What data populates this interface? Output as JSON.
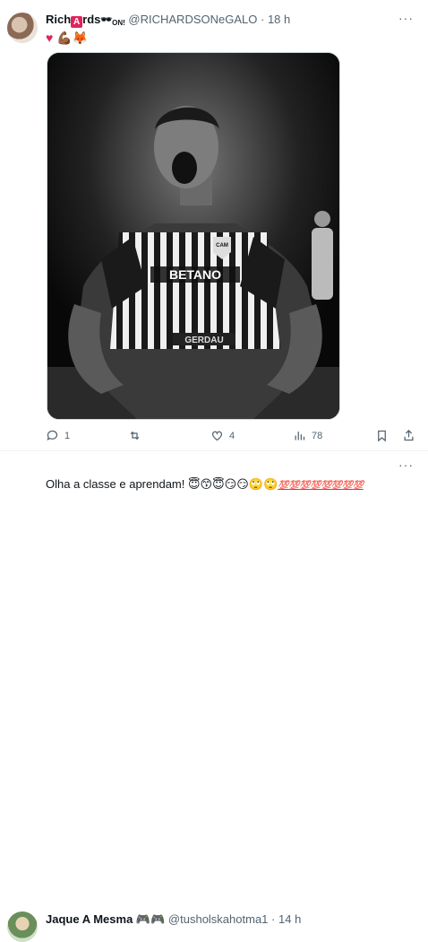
{
  "tweet1": {
    "name_part1": "Rich",
    "name_box": "A",
    "name_part2": "rds",
    "name_suffix": "ON!",
    "handle": "@RICHARDSONeGALO",
    "dot": "·",
    "time": "18 h",
    "more": "···",
    "bio_emojis": "💪🏾🦊",
    "media_text": {
      "sponsor": "BETANO",
      "badge": "CAM",
      "sleeve": "GERDAU"
    },
    "actions": {
      "reply_count": "1",
      "retweet_count": "",
      "like_count": "4",
      "views_count": "78"
    }
  },
  "tweet2": {
    "name": "Jaque A Mesma",
    "name_emojis": "🎮🎮",
    "handle": "@tusholskahotma1",
    "dot": "·",
    "time": "14 h",
    "more": "···",
    "text": "Olha a classe e aprendam!",
    "emojis": "😇😙😇😏😏🙄🙄",
    "hundreds": "💯💯💯💯💯💯💯💯"
  },
  "colors": {
    "like_red": "#e0245e",
    "muted": "#536471",
    "text": "#0f1419"
  }
}
